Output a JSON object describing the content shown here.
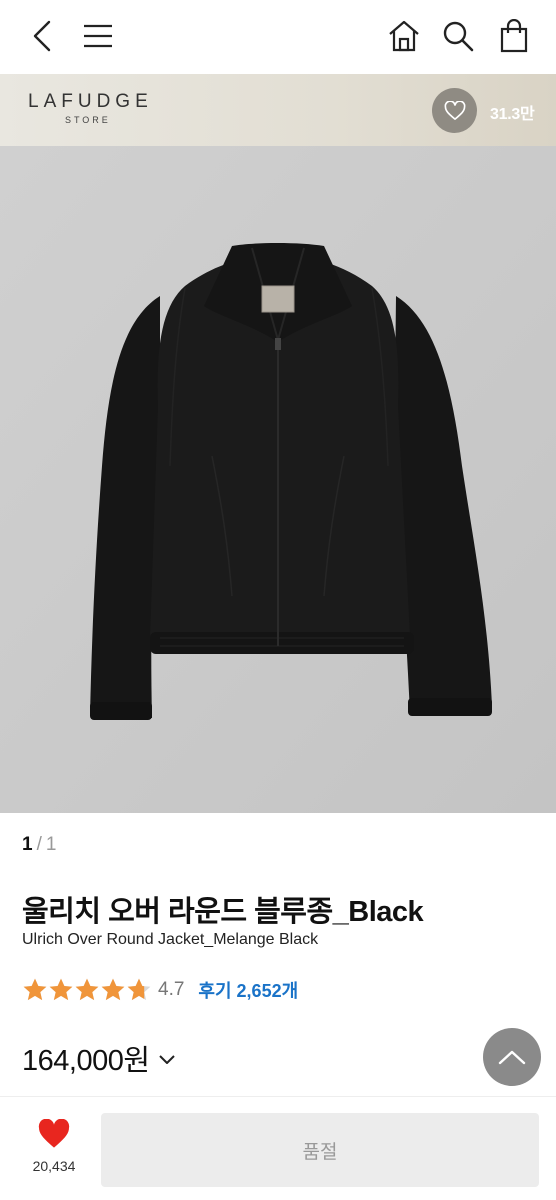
{
  "header": {
    "icons": [
      "back-icon",
      "menu-icon",
      "home-icon",
      "search-icon",
      "shopping-bag-icon"
    ]
  },
  "brand": {
    "name": "LAFUDGE",
    "sub": "STORE",
    "like_count": "31.3만"
  },
  "product": {
    "image_pager": {
      "current": "1",
      "separator": "/",
      "total": "1"
    },
    "title_ko": "울리치 오버 라운드 블루종_Black",
    "title_en": "Ulrich Over Round Jacket_Melange Black",
    "rating": 4.7,
    "rating_label": "4.7",
    "reviews_label": "후기 2,652개",
    "price": "164,000원"
  },
  "bottom": {
    "wish_count": "20,434",
    "cta_label": "품절"
  },
  "colors": {
    "star": "#f0953a",
    "review_link": "#1a73c8",
    "heart": "#e8261f"
  }
}
